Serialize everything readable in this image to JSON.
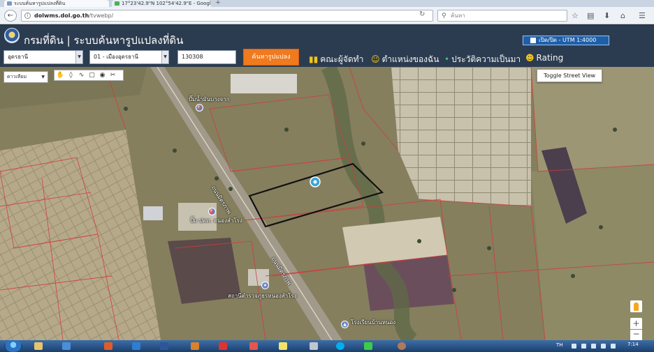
{
  "browser": {
    "tabs": [
      {
        "label": "ระบบค้นหารูปแปลงที่ดิน",
        "active": true
      },
      {
        "label": "17°23'42.9\"N 102°54'42.9\"E - Google Maps",
        "active": false
      }
    ],
    "new_tab_label": "+",
    "url_host": "dolwms.dol.go.th",
    "url_path": "/tvwebp/",
    "search_placeholder": "ค้นหา"
  },
  "site": {
    "title": "กรมที่ดิน | ระบบค้นหารูปแปลงที่ดิน",
    "utm_toggle_label": "เปิด/ปิด - UTM 1:4000",
    "province_select": "อุดรธานี",
    "district_select": "01 - เมืองอุดรธานี",
    "parcel_number": "130308",
    "search_button": "ค้นหารูปแปลง",
    "nav": {
      "credits": "คณะผู้จัดทำ",
      "my_location": "ตำแหน่งของฉัน",
      "history": "ประวัติความเป็นมา",
      "rating": "Rating"
    }
  },
  "map": {
    "map_type": "ดาวเทียม",
    "toggle_street_view": "Toggle Street View",
    "zoom_in": "+",
    "zoom_out": "−",
    "labels": {
      "gas_station_top": "ปั๊มน้ำมันบางจาก",
      "road_1": "ถนนมิตรภาพ",
      "road_2": "ถนนมิตรภาพ",
      "gas_station_ptt": "ปั๊ม ปตท. หนองสำโรง",
      "police_station": "สถานีตำรวจภูธรหนองสำโรง",
      "school": "โรงเรียนบ้านหนอง"
    }
  },
  "taskbar": {
    "language": "TH",
    "clock": "7:14"
  },
  "colors": {
    "header_bg": "#2c3c50",
    "search_button_bg": "#f07a1e",
    "utm_toggle_bg": "#1f5fa8",
    "parcel_outline": "#111111",
    "boundary_lines": "#d23a3a"
  }
}
